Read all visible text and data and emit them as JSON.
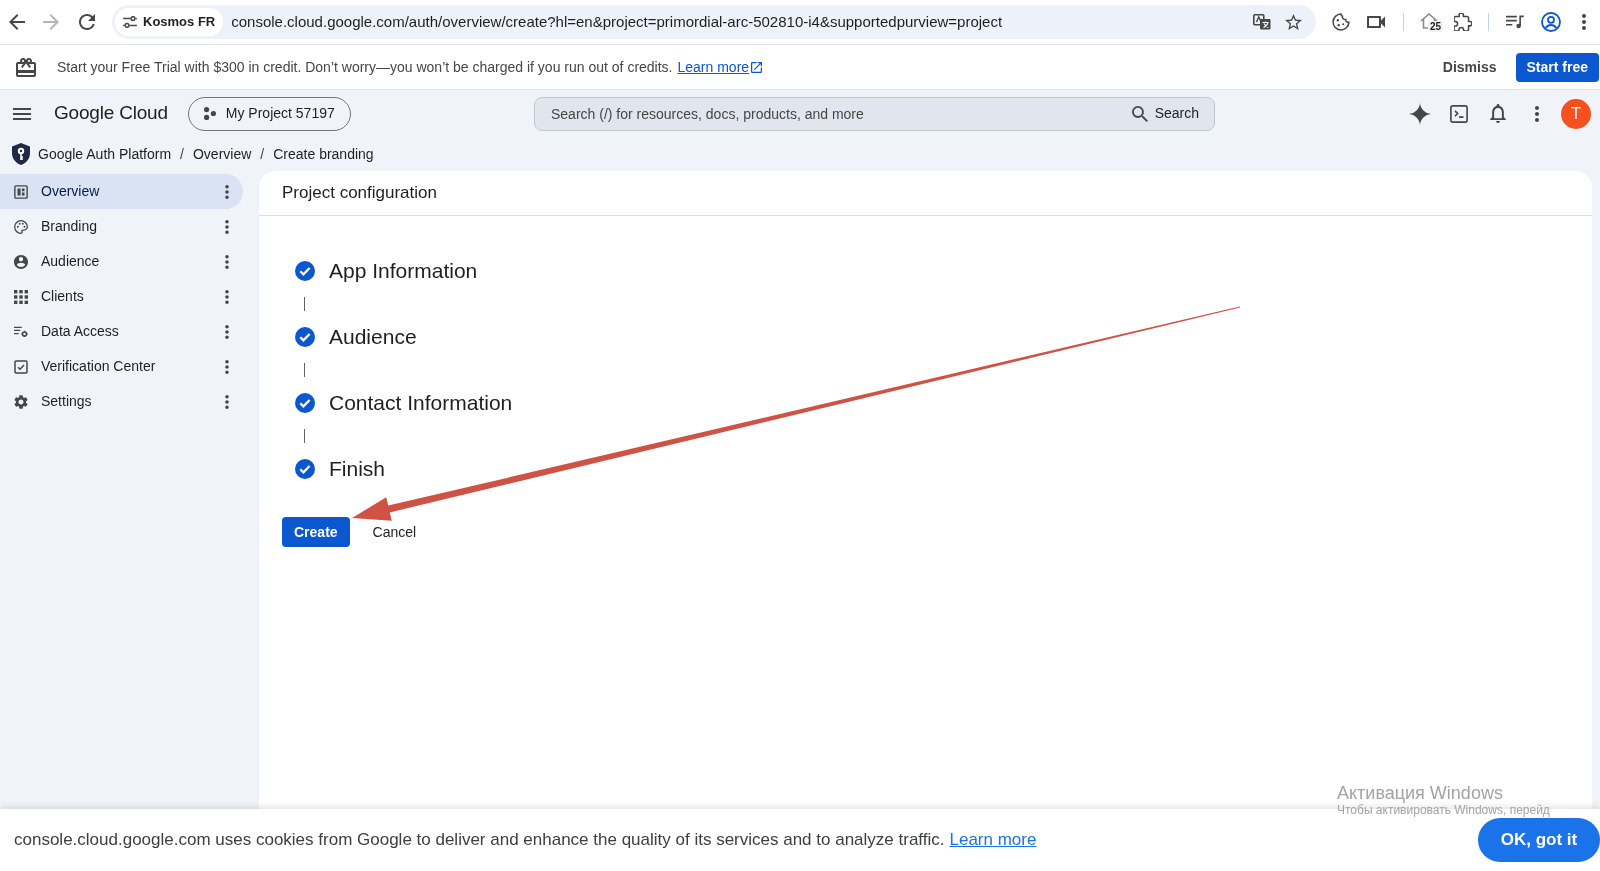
{
  "browser": {
    "forward_disabled": true,
    "site_chip": "Kosmos FR",
    "url": "console.cloud.google.com/auth/overview/create?hl=en&project=primordial-arc-502810-i4&supportedpurview=project",
    "extension_badge": "25"
  },
  "trial_banner": {
    "text": "Start your Free Trial with $300 in credit. Don’t worry—you won’t be charged if you run out of credits.",
    "link": "Learn more",
    "dismiss_button": "Dismiss",
    "start_button": "Start free"
  },
  "header": {
    "logo": "Google Cloud",
    "project_picker": "My Project 57197",
    "search": {
      "placeholder": "Search (/) for resources, docs, products, and more",
      "button": "Search"
    },
    "avatar": "T"
  },
  "breadcrumb": [
    {
      "label": "Google Auth Platform"
    },
    {
      "separator": "/",
      "label": "Overview"
    },
    {
      "separator": "/",
      "label": "Create branding"
    }
  ],
  "sidebar": {
    "items": [
      {
        "label": "Overview",
        "selected": true
      },
      {
        "label": "Branding",
        "selected": false
      },
      {
        "label": "Audience",
        "selected": false
      },
      {
        "label": "Clients",
        "selected": false
      },
      {
        "label": "Data Access",
        "selected": false
      },
      {
        "label": "Verification Center",
        "selected": false
      },
      {
        "label": "Settings",
        "selected": false
      }
    ]
  },
  "panel": {
    "title": "Project configuration",
    "steps": [
      {
        "label": "App Information",
        "done": true
      },
      {
        "label": "Audience",
        "done": true
      },
      {
        "label": "Contact Information",
        "done": true
      },
      {
        "label": "Finish",
        "done": true
      }
    ],
    "actions": [
      {
        "label": "Create",
        "kind": "primary"
      },
      {
        "label": "Cancel",
        "kind": "text"
      }
    ]
  },
  "cookie_bar": {
    "text": "console.cloud.google.com uses cookies from Google to deliver and enhance the quality of its services and to analyze traffic.",
    "link": "Learn more",
    "button": "OK, got it"
  },
  "activation_notice": {
    "title": "Активация Windows",
    "text": "Чтобы активировать Windows, перейд"
  }
}
